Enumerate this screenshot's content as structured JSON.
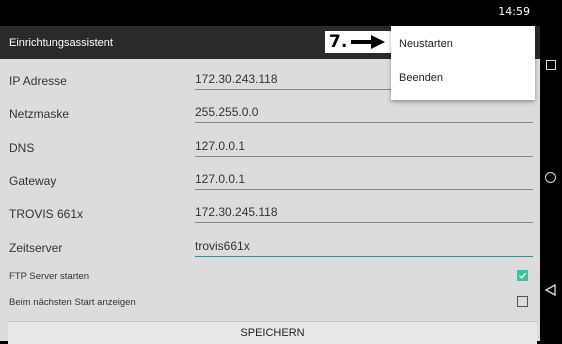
{
  "status_bar": {
    "time": "14:59"
  },
  "app_bar": {
    "title": "Einrichtungsassistent"
  },
  "annotation": {
    "label": "7."
  },
  "overflow_menu": {
    "items": [
      "Neustarten",
      "Beenden"
    ]
  },
  "fields": [
    {
      "label": "IP Adresse",
      "value": "172.30.243.118",
      "focused": false
    },
    {
      "label": "Netzmaske",
      "value": "255.255.0.0",
      "focused": false
    },
    {
      "label": "DNS",
      "value": "127.0.0.1",
      "focused": false
    },
    {
      "label": "Gateway",
      "value": "127.0.0.1",
      "focused": false
    },
    {
      "label": "TROVIS 661x",
      "value": "172.30.245.118",
      "focused": false
    },
    {
      "label": "Zeitserver",
      "value": "trovis661x",
      "focused": true
    }
  ],
  "checkboxes": [
    {
      "label": "FTP Server starten",
      "checked": true
    },
    {
      "label": "Beim nächsten Start anzeigen",
      "checked": false
    }
  ],
  "save_button": {
    "label": "SPEICHERN"
  },
  "colors": {
    "accent": "#3fc1a8",
    "app_bar": "#2a2a2a",
    "background": "#dcdcdc"
  },
  "icons": {
    "nav_recent": "square-icon",
    "nav_home": "circle-icon",
    "nav_back": "triangle-back-icon",
    "checkmark": "check-icon",
    "annotation_arrow": "arrow-right-icon"
  }
}
